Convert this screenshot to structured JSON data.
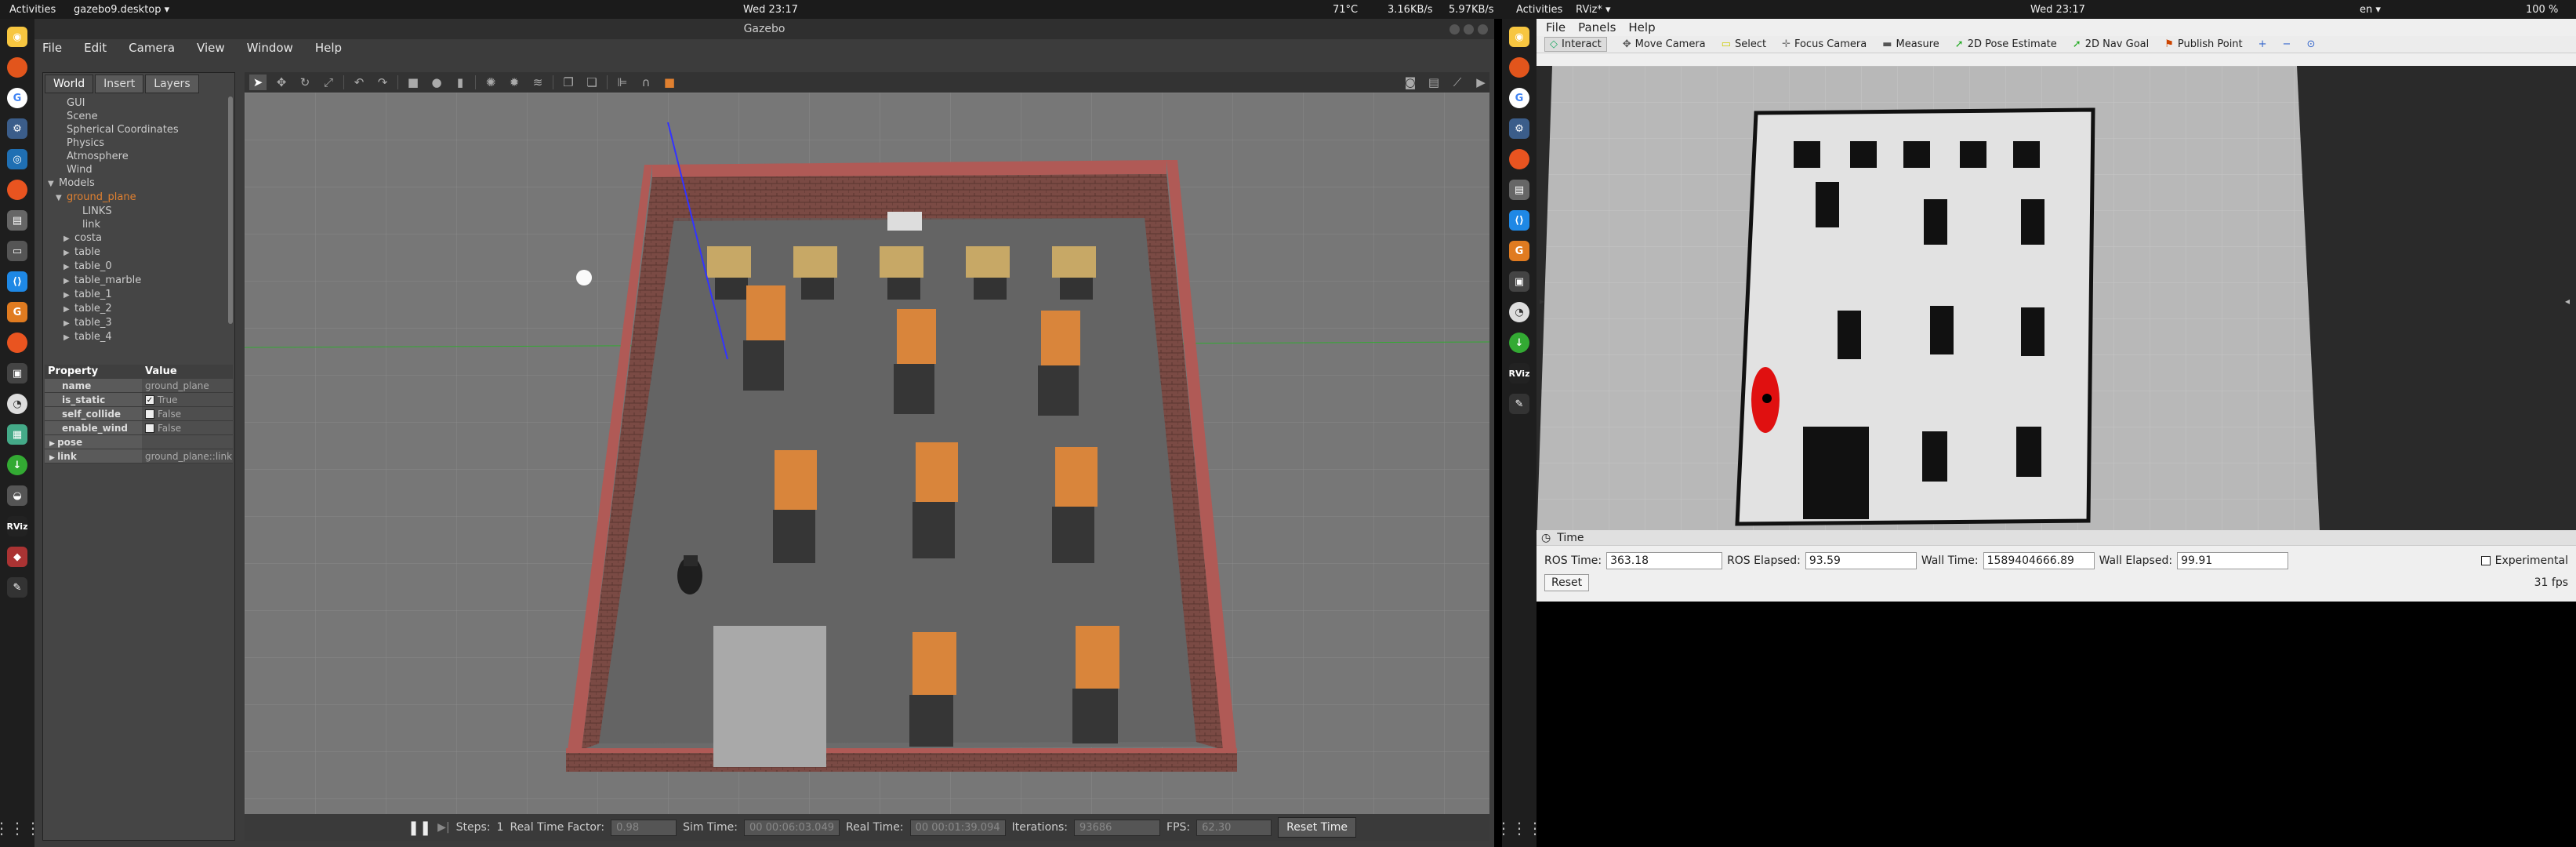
{
  "left_screen": {
    "topbar": {
      "activities": "Activities",
      "app": "gazebo9.desktop ▾",
      "clock": "Wed 23:17",
      "temp": "71°C",
      "net_down": "3.16KB/s",
      "net_up": "5.97KB/s"
    },
    "gazebo": {
      "title": "Gazebo",
      "menu": [
        "File",
        "Edit",
        "Camera",
        "View",
        "Window",
        "Help"
      ],
      "tabs": [
        "World",
        "Insert",
        "Layers"
      ],
      "tree": [
        {
          "label": "GUI",
          "indent": 1,
          "arrow": ""
        },
        {
          "label": "Scene",
          "indent": 1,
          "arrow": ""
        },
        {
          "label": "Spherical Coordinates",
          "indent": 1,
          "arrow": ""
        },
        {
          "label": "Physics",
          "indent": 1,
          "arrow": ""
        },
        {
          "label": "Atmosphere",
          "indent": 1,
          "arrow": ""
        },
        {
          "label": "Wind",
          "indent": 1,
          "arrow": ""
        },
        {
          "label": "Models",
          "indent": 0,
          "arrow": "▼"
        },
        {
          "label": "ground_plane",
          "indent": 1,
          "arrow": "▼",
          "selected": true
        },
        {
          "label": "LINKS",
          "indent": 3,
          "arrow": ""
        },
        {
          "label": "link",
          "indent": 3,
          "arrow": ""
        },
        {
          "label": "costa",
          "indent": 2,
          "arrow": "▶"
        },
        {
          "label": "table",
          "indent": 2,
          "arrow": "▶"
        },
        {
          "label": "table_0",
          "indent": 2,
          "arrow": "▶"
        },
        {
          "label": "table_marble",
          "indent": 2,
          "arrow": "▶"
        },
        {
          "label": "table_1",
          "indent": 2,
          "arrow": "▶"
        },
        {
          "label": "table_2",
          "indent": 2,
          "arrow": "▶"
        },
        {
          "label": "table_3",
          "indent": 2,
          "arrow": "▶"
        },
        {
          "label": "table_4",
          "indent": 2,
          "arrow": "▶"
        }
      ],
      "props_header": {
        "property": "Property",
        "value": "Value"
      },
      "props": [
        {
          "key": "name",
          "value": "ground_plane",
          "check": false
        },
        {
          "key": "is_static",
          "value": "True",
          "check": true
        },
        {
          "key": "self_collide",
          "value": "False",
          "check": false,
          "box": true
        },
        {
          "key": "enable_wind",
          "value": "False",
          "check": false,
          "box": true
        }
      ],
      "props_expand": [
        {
          "key": "pose",
          "value": ""
        },
        {
          "key": "link",
          "value": "ground_plane::link"
        }
      ],
      "bottom": {
        "steps_label": "Steps:",
        "steps_value": "1",
        "rtf_label": "Real Time Factor:",
        "rtf_value": "0.98",
        "sim_label": "Sim Time:",
        "sim_value": "00 00:06:03.049",
        "real_label": "Real Time:",
        "real_value": "00 00:01:39.094",
        "iter_label": "Iterations:",
        "iter_value": "93686",
        "fps_label": "FPS:",
        "fps_value": "62.30",
        "reset": "Reset Time"
      }
    }
  },
  "right_screen": {
    "topbar": {
      "activities": "Activities",
      "app": "RViz* ▾",
      "clock": "Wed 23:17",
      "lang": "en ▾",
      "battery": "100 %"
    },
    "rviz": {
      "menu": [
        "File",
        "Panels",
        "Help"
      ],
      "tools": [
        "Interact",
        "Move Camera",
        "Select",
        "Focus Camera",
        "Measure",
        "2D Pose Estimate",
        "2D Nav Goal",
        "Publish Point"
      ],
      "time_panel": {
        "title": "Time",
        "ros_time_label": "ROS Time:",
        "ros_time": "363.18",
        "ros_elapsed_label": "ROS Elapsed:",
        "ros_elapsed": "93.59",
        "wall_time_label": "Wall Time:",
        "wall_time": "1589404666.89",
        "wall_elapsed_label": "Wall Elapsed:",
        "wall_elapsed": "99.91",
        "experimental": "Experimental",
        "reset": "Reset",
        "fps": "31 fps"
      }
    }
  }
}
